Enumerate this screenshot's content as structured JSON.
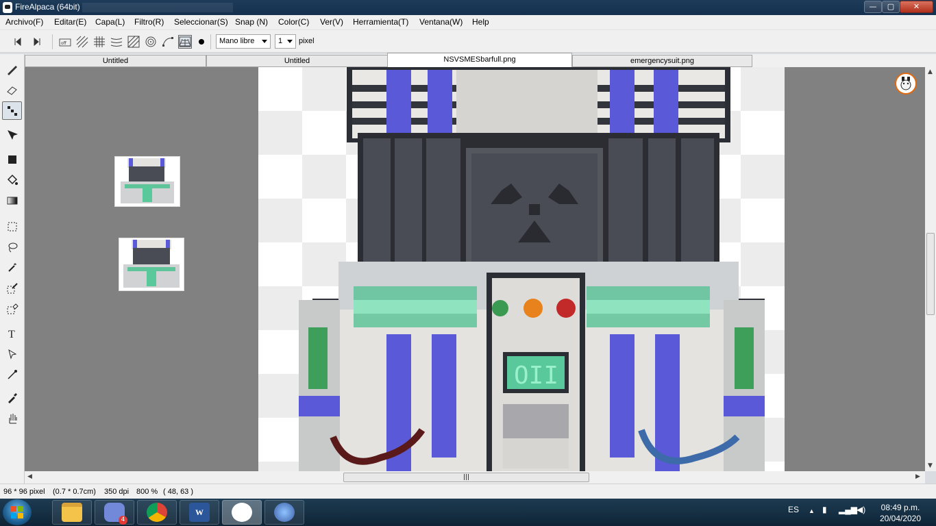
{
  "window": {
    "title": "FireAlpaca (64bit)",
    "minimize": "—",
    "maximize": "▢",
    "close": "✕"
  },
  "menu": [
    "Archivo(F)",
    "Editar(E)",
    "Capa(L)",
    "Filtro(R)",
    "Seleccionar(S)",
    "Snap (N)",
    "Color(C)",
    "Ver(V)",
    "Herramienta(T)",
    "Ventana(W)",
    "Help"
  ],
  "toolbar": {
    "brush_mode": "Mano libre",
    "brush_size": "1",
    "unit": "pixel",
    "snap_icons": [
      "snap-off-icon",
      "parallel-snap-icon",
      "grid-snap-icon",
      "horizontal-snap-icon",
      "diagonal-snap-icon",
      "concentric-snap-icon",
      "curve-snap-icon",
      "perspective-snap-icon"
    ]
  },
  "tabs": [
    "Untitled",
    "Untitled",
    "NSVSMESbarfull.png",
    "emergencysuit.png"
  ],
  "active_tab": "NSVSMESbarfull.png",
  "tools": [
    "pen-icon",
    "eraser-icon",
    "dot-pen-icon",
    "move-icon",
    "fill-rect-icon",
    "bucket-icon",
    "gradient-icon",
    "rect-select-icon",
    "lasso-icon",
    "magic-wand-icon",
    "select-pen-icon",
    "select-eraser-icon",
    "text-icon",
    "operation-icon",
    "divide-icon",
    "eyedropper-icon",
    "hand-icon"
  ],
  "status": {
    "size": "96 * 96 pixel",
    "cm": "(0.7 * 0.7cm)",
    "dpi": "350 dpi",
    "zoom": "800 %",
    "coords": "( 48, 63 )"
  },
  "taskbar": {
    "apps": [
      "explorer-icon",
      "discord-icon",
      "chrome-icon",
      "word-icon",
      "firealpaca-icon",
      "ryujinx-icon"
    ],
    "discord_badge": "4",
    "language": "ES",
    "time": "08:49 p.m.",
    "date": "20/04/2020"
  },
  "colors": {
    "accent_blue": "#5a5ad8",
    "machine_gray": "#4a4c55",
    "glow_green": "#5fc49a",
    "button_red": "#c22a2a",
    "button_orange": "#e8821c",
    "button_green": "#3a9a52"
  }
}
